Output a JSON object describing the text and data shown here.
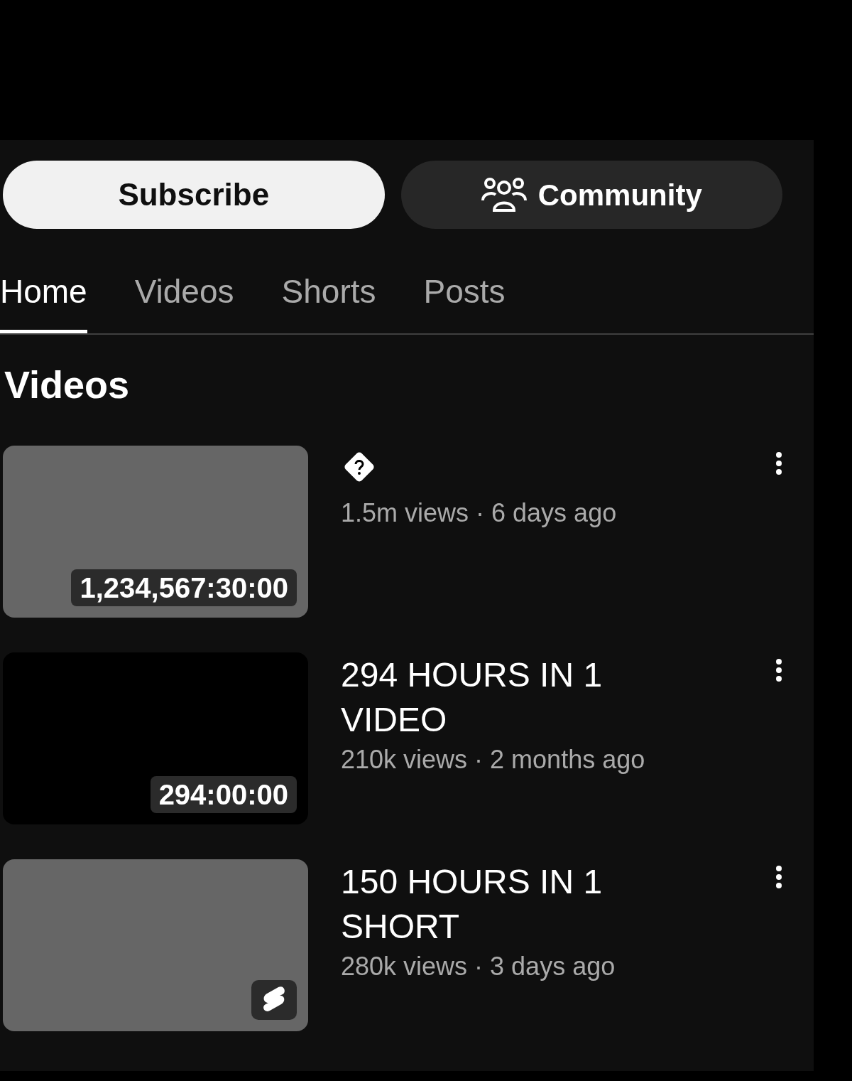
{
  "buttons": {
    "subscribe": "Subscribe",
    "community": "Community"
  },
  "tabs": [
    {
      "label": "Home",
      "selected": true
    },
    {
      "label": "Videos",
      "selected": false
    },
    {
      "label": "Shorts",
      "selected": false
    },
    {
      "label": "Posts",
      "selected": false
    }
  ],
  "section_title": "Videos",
  "videos": [
    {
      "kind": "untitled",
      "color": "#666666",
      "badge": {
        "kind": "duration",
        "text": "1,234,567:30:00"
      },
      "meta": "1.5m views · 6 days ago"
    },
    {
      "kind": "titled",
      "color": "#000000",
      "title": "294 HOURS IN 1 VIDEO",
      "badge": {
        "kind": "duration",
        "text": "294:00:00"
      },
      "meta": "210k views · 2 months ago"
    },
    {
      "kind": "titled",
      "color": "#666666",
      "title": "150 HOURS IN 1 SHORT",
      "badge": {
        "kind": "shorts"
      },
      "meta": "280k views · 3 days ago"
    }
  ]
}
